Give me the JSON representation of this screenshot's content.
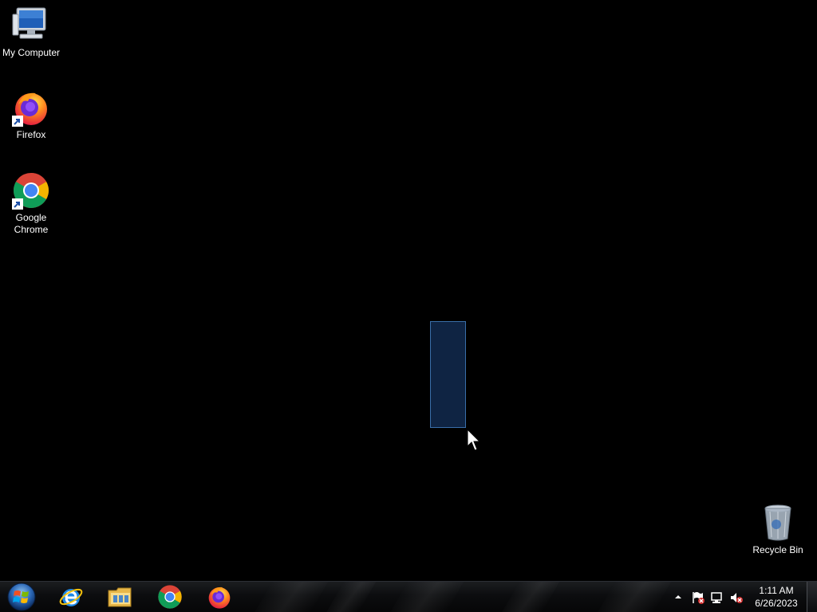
{
  "desktop": {
    "icons": [
      {
        "label": "My Computer",
        "icon": "my-computer-icon"
      },
      {
        "label": "Firefox",
        "icon": "firefox-icon"
      },
      {
        "label": "Google Chrome",
        "icon": "chrome-icon"
      },
      {
        "label": "Recycle Bin",
        "icon": "recycle-bin-icon"
      }
    ]
  },
  "taskbar": {
    "start": "start-orb-icon",
    "pinned": [
      {
        "name": "Internet Explorer",
        "icon": "internet-explorer-icon"
      },
      {
        "name": "Windows Explorer",
        "icon": "file-explorer-icon"
      },
      {
        "name": "Google Chrome",
        "icon": "chrome-icon"
      },
      {
        "name": "Firefox",
        "icon": "firefox-icon"
      }
    ],
    "tray": {
      "icons": [
        "show-hidden-icons-arrow",
        "action-center-flag-icon",
        "network-icon",
        "volume-muted-icon"
      ],
      "time": "1:11 AM",
      "date": "6/26/2023"
    }
  },
  "colors": {
    "desktop_background": "#000000",
    "selection_fill": "#11284a",
    "selection_border": "#3a6ea8"
  }
}
